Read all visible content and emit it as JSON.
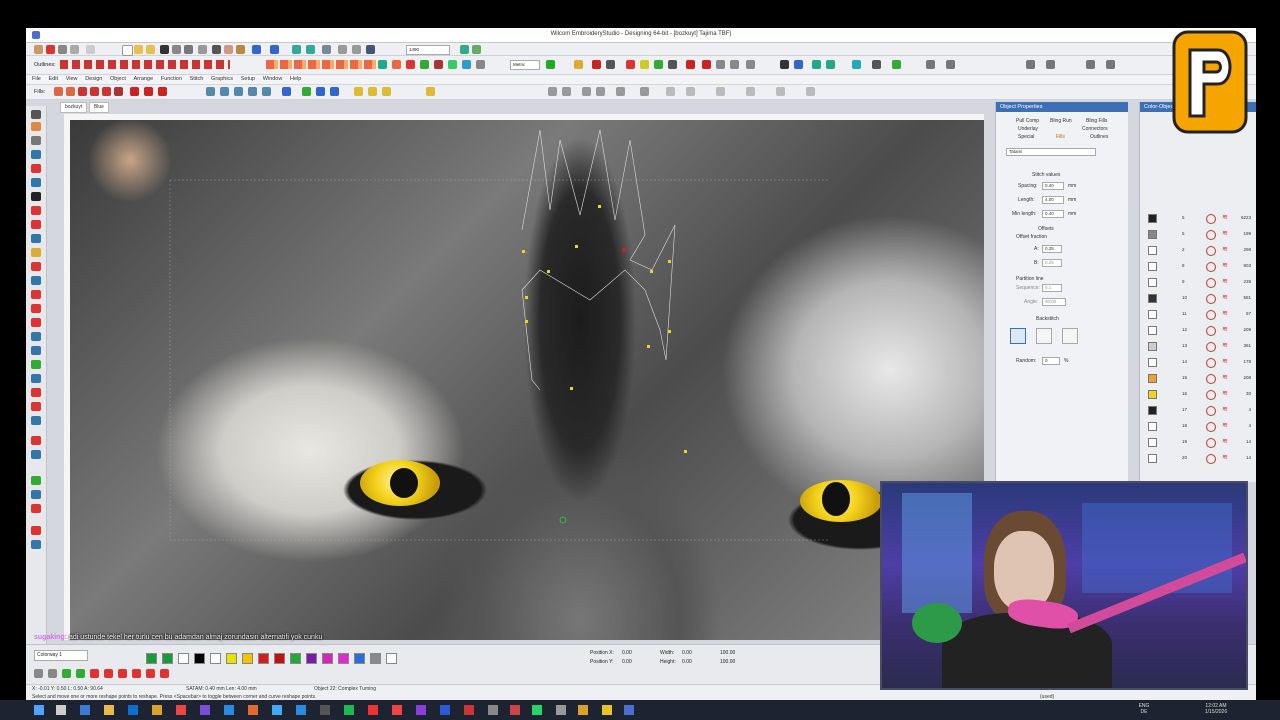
{
  "window": {
    "title": "Wilcom EmbroideryStudio - Designing 64-bit - [bozkuyt]   Tajima TBF)"
  },
  "toolbar": {
    "outlines_label": "Outlines:",
    "fills_label": "Fills:",
    "font_size_value": "1490",
    "metric_value": "Metric"
  },
  "menu": {
    "items": [
      "File",
      "Edit",
      "View",
      "Design",
      "Object",
      "Arrange",
      "Function",
      "Stitch",
      "Graphics",
      "Setup",
      "Window",
      "Help"
    ]
  },
  "tabs": [
    {
      "label": "bozkuyt"
    },
    {
      "label": "Blue"
    }
  ],
  "object_properties": {
    "header": "Object Properties",
    "tabs_row1": [
      "Pull Comp",
      "Bling Run",
      "Bling Fills"
    ],
    "tabs_row2": [
      "Underlay",
      "Connectors"
    ],
    "tabs_row3": [
      "Special",
      "Fills",
      "Outlines"
    ],
    "fill_type": "Tatami",
    "section_stitch": "Stitch values",
    "spacing_label": "Spacing:",
    "spacing_value": "0.40",
    "length_label": "Length:",
    "length_value": "4.00",
    "minlength_label": "Min length:",
    "minlength_value": "0.40",
    "unit": "mm",
    "offsets_label": "Offsets",
    "offset_fraction_label": "Offset fraction",
    "a_label": "A:",
    "a_value": "0.25",
    "b_label": "B:",
    "b_value": "0.25",
    "partition_label": "Partition line",
    "sequence_label": "Sequence:",
    "sequence_value": "0.1",
    "angle_label": "Angle:",
    "angle_value": "90.00",
    "backstitch_label": "Backstitch",
    "random_label": "Random:",
    "random_value": "0",
    "random_unit": "%"
  },
  "color_objects": {
    "header": "Color-Object List",
    "rows": [
      {
        "num": "5",
        "count": "6223",
        "color": "#222222"
      },
      {
        "num": "5",
        "count": "199",
        "color": "#888888"
      },
      {
        "num": "2",
        "count": "298",
        "color": "#ffffff"
      },
      {
        "num": "8",
        "count": "803",
        "color": "#ffffff"
      },
      {
        "num": "9",
        "count": "239",
        "color": "#ffffff"
      },
      {
        "num": "10",
        "count": "581",
        "color": "#333333"
      },
      {
        "num": "11",
        "count": "97",
        "color": "#ffffff"
      },
      {
        "num": "12",
        "count": "209",
        "color": "#ffffff"
      },
      {
        "num": "13",
        "count": "361",
        "color": "#cccccc"
      },
      {
        "num": "14",
        "count": "178",
        "color": "#ffffff"
      },
      {
        "num": "15",
        "count": "208",
        "color": "#f0a030"
      },
      {
        "num": "16",
        "count": "30",
        "color": "#f2d320"
      },
      {
        "num": "17",
        "count": "4",
        "color": "#222222"
      },
      {
        "num": "18",
        "count": "4",
        "color": "#ffffff"
      },
      {
        "num": "19",
        "count": "14",
        "color": "#ffffff"
      },
      {
        "num": "20",
        "count": "14",
        "color": "#ffffff"
      }
    ]
  },
  "chat": {
    "username": "sugaking:",
    "message": "adi ustunde tekel her turlu cen bu adamdan almaj zorundasin alternatifi yok cunku"
  },
  "bottom": {
    "colorway_label": "Colorway 1",
    "position_x_label": "Position X:",
    "position_x_value": "0.00",
    "position_y_label": "Position Y:",
    "position_y_value": "0.00",
    "width_label": "Width:",
    "width_value": "0.00",
    "height_label": "Height:",
    "height_value": "0.00",
    "unit": "mm",
    "pct1": "100.00",
    "pct2": "100.00",
    "swatches": [
      "#1a9a3a",
      "#1a9a3a",
      "#ffffff",
      "#000000",
      "#ffffff",
      "#e4e400",
      "#f5c400",
      "#d21e1e",
      "#c01010",
      "#27a83a",
      "#7a1aa8",
      "#d228b4",
      "#e02ad0",
      "#2c6ed8",
      "#8a8a8a",
      "#ffffff"
    ]
  },
  "status": {
    "coords": "X: -0.01  Y: 0.50  L: 0.50  A: 90.64",
    "stitch_info": "SATAM: 0.40 mm  Len: 4.00 mm",
    "object_info": "Object 22: Complex Turning",
    "hint": "Select and move one or more reshape points to reshape. Press <Spacebar> to toggle between corner and curve reshape points.",
    "used": "(used)"
  },
  "taskbar": {
    "lang": "ENG",
    "region": "DE",
    "time": "12:02 AM",
    "date": "1/15/2026"
  },
  "colors": {
    "accent": "#3c6fb5",
    "thread_yellow": "#f2d320",
    "node_red": "#cc2222"
  }
}
